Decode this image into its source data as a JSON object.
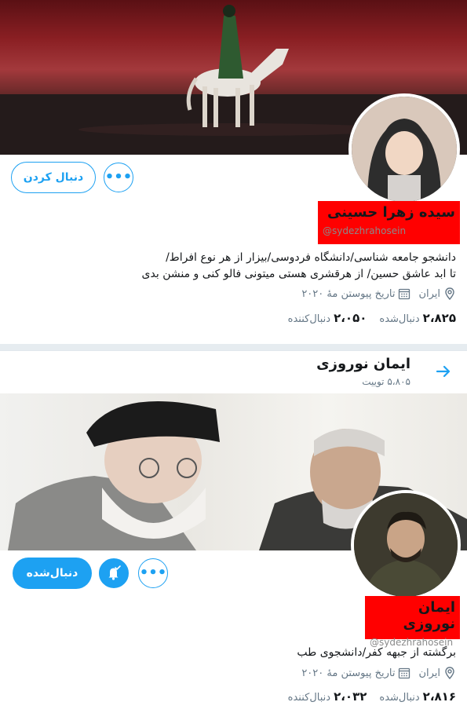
{
  "profile1": {
    "name": "سیده زهرا حسینی",
    "handle": "@sydezhrahosein",
    "bio_line1": "دانشجو جامعه شناسی/دانشگاه فردوسی/بیزار از هر نوع افراط/",
    "bio_line2": "تا ابد عاشق حسین/ از هرقشری هستی میتونی فالو کنی و منشن بدی",
    "location": "ایران",
    "joined": "تاریخ پیوستن مهٔ ۲۰۲۰",
    "following_count": "۲،۸۲۵",
    "following_label": "دنبال‌شده",
    "followers_count": "۲،۰۵۰",
    "followers_label": "دنبال‌کننده",
    "follow_button": "دنبال کردن"
  },
  "profile2": {
    "header_title": "ایمان نوروزی",
    "header_sub": "۵،۸۰۵ توییت",
    "name": "ایمان نوروزی",
    "handle": "@sydezhrahosein",
    "bio": "برگشته از جبهه کفر/دانشجوی طب",
    "location": "ایران",
    "joined": "تاریخ پیوستن مهٔ ۲۰۲۰",
    "following_count": "۲،۸۱۶",
    "following_label": "دنبال‌شده",
    "followers_count": "۲،۰۳۲",
    "followers_label": "دنبال‌کننده",
    "following_button": "دنبال‌شده"
  },
  "colors": {
    "accent": "#1da1f2",
    "name_highlight": "#ff0000",
    "muted": "#657786"
  }
}
